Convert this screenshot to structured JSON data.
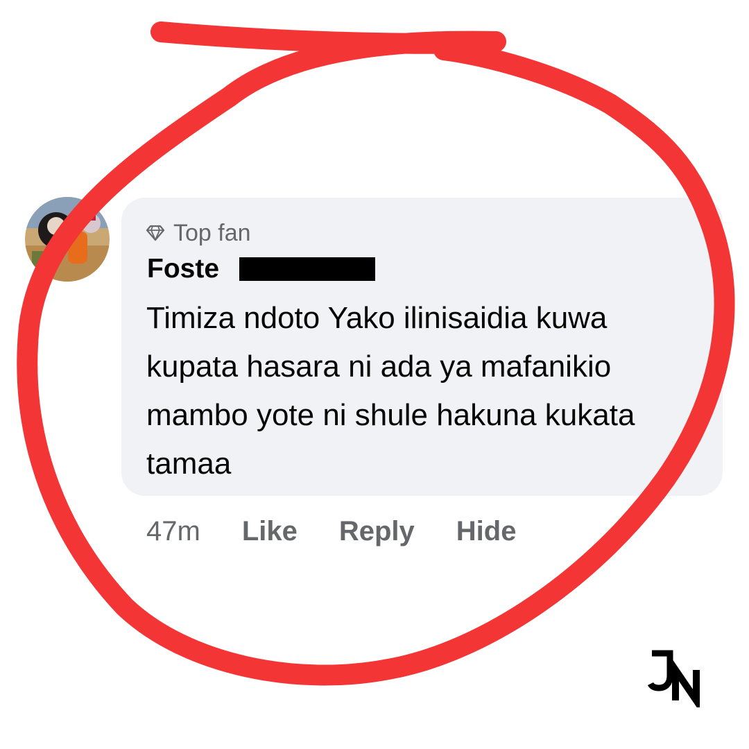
{
  "comment": {
    "badge_icon": "diamond-icon",
    "badge_label": "Top fan",
    "author_visible": "Foste",
    "text": "Timiza ndoto Yako ilinisaidia kuwa kupata hasara ni ada ya mafanikio mambo yote ni shule hakuna kukata tamaa",
    "time": "47m",
    "actions": {
      "like": "Like",
      "reply": "Reply",
      "hide": "Hide"
    }
  },
  "overlay": {
    "annotation_color": "#f43535",
    "logo": "JN"
  },
  "colors": {
    "bubble": "#f0f2f5",
    "text": "#050505",
    "secondary": "#65676b"
  }
}
